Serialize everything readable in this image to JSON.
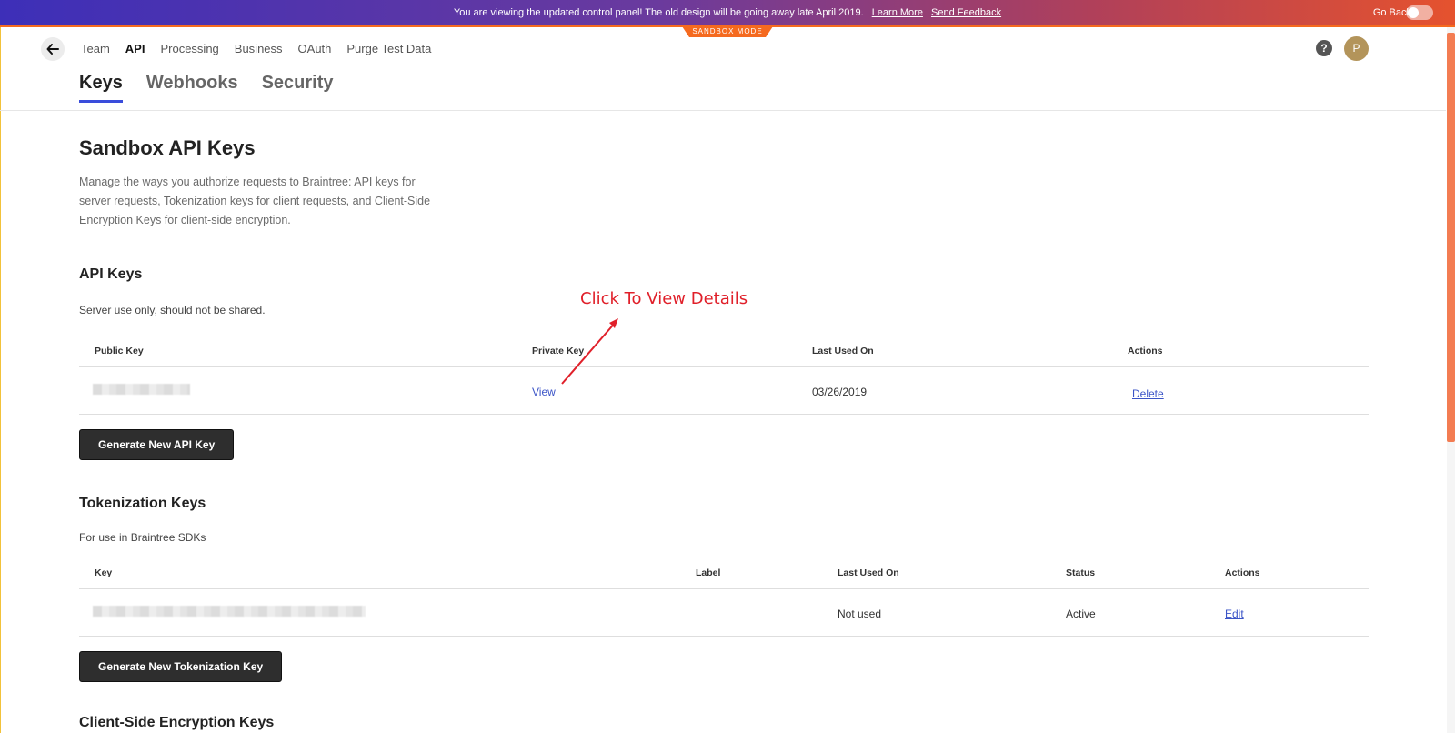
{
  "banner": {
    "message": "You are viewing the updated control panel! The old design will be going away late April 2019.",
    "learn_more": "Learn More",
    "send_feedback": "Send Feedback",
    "go_back": "Go Back",
    "sandbox_label": "SANDBOX MODE"
  },
  "topnav": {
    "items": [
      "Team",
      "API",
      "Processing",
      "Business",
      "OAuth",
      "Purge Test Data"
    ],
    "active": "API",
    "avatar_initial": "P",
    "help": "?"
  },
  "tabs": [
    {
      "label": "Keys",
      "active": true
    },
    {
      "label": "Webhooks",
      "active": false
    },
    {
      "label": "Security",
      "active": false
    }
  ],
  "page": {
    "title": "Sandbox API Keys",
    "description": "Manage the ways you authorize requests to Braintree: API keys for server requests, Tokenization keys for client requests, and Client-Side Encryption Keys for client-side encryption."
  },
  "api_keys": {
    "title": "API Keys",
    "subtitle": "Server use only, should not be shared.",
    "columns": [
      "Public Key",
      "Private Key",
      "Last Used On",
      "Actions"
    ],
    "rows": [
      {
        "public_key": "",
        "private_key_link": "View",
        "last_used": "03/26/2019",
        "action": "Delete"
      }
    ],
    "button": "Generate New API Key"
  },
  "tokenization_keys": {
    "title": "Tokenization Keys",
    "subtitle": "For use in Braintree SDKs",
    "columns": [
      "Key",
      "Label",
      "Last Used On",
      "Status",
      "Actions"
    ],
    "rows": [
      {
        "key": "",
        "label": "",
        "last_used": "Not used",
        "status": "Active",
        "action": "Edit"
      }
    ],
    "button": "Generate New Tokenization Key"
  },
  "cse_keys": {
    "title": "Client-Side Encryption Keys"
  },
  "annotation": {
    "text": "Click To View Details",
    "color": "#e0202a"
  },
  "colors": {
    "accent": "#3a4ddb",
    "sandbox_orange": "#f56a1f",
    "button_dark": "#2e2e2e",
    "link": "#3b54c7"
  }
}
